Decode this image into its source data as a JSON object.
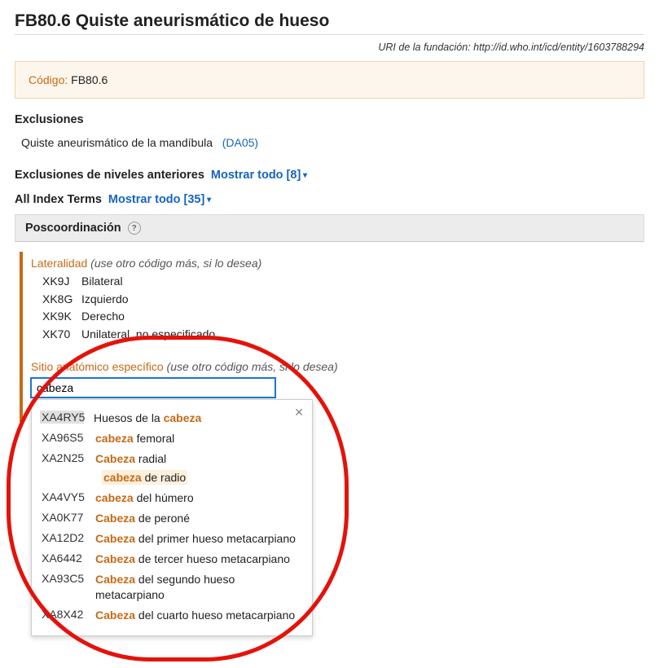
{
  "page_title": "FB80.6 Quiste aneurismático de hueso",
  "uri_label": "URI de la fundación:",
  "uri_value": "http://id.who.int/icd/entity/1603788294",
  "code_label": "Código:",
  "code_value": "FB80.6",
  "exclusions": {
    "heading": "Exclusiones",
    "item_text": "Quiste aneurismático de la mandíbula",
    "item_link": "(DA05)"
  },
  "prior_exclusions": {
    "heading": "Exclusiones de niveles anteriores",
    "show_all": "Mostrar todo [8]"
  },
  "index_terms": {
    "heading": "All Index Terms",
    "show_all": "Mostrar todo [35]"
  },
  "postcoord": {
    "heading": "Poscoordinación",
    "laterality": {
      "title": "Lateralidad",
      "hint": "(use otro código más, si lo desea)",
      "items": [
        {
          "code": "XK9J",
          "label": "Bilateral"
        },
        {
          "code": "XK8G",
          "label": "Izquierdo"
        },
        {
          "code": "XK9K",
          "label": "Derecho"
        },
        {
          "code": "XK70",
          "label": "Unilateral, no especificado"
        }
      ]
    },
    "site": {
      "title": "Sitio anatómico específico",
      "hint": "(use otro código más, si lo desea)",
      "search_value": "cabeza",
      "dropdown": {
        "rows": [
          {
            "code": "XA4RY5",
            "selected": true,
            "pre": "Huesos de la ",
            "hl": "cabeza",
            "post": ""
          },
          {
            "code": "XA96S5",
            "selected": false,
            "pre": "",
            "hl": "cabeza",
            "post": " femoral"
          },
          {
            "code": "XA2N25",
            "selected": false,
            "pre": "",
            "hl": "Cabeza",
            "post": " radial",
            "sub": {
              "pre": "",
              "hl": "cabeza",
              "post": " de radio"
            }
          },
          {
            "code": "XA4VY5",
            "selected": false,
            "pre": "",
            "hl": "cabeza",
            "post": " del húmero"
          },
          {
            "code": "XA0K77",
            "selected": false,
            "pre": "",
            "hl": "Cabeza",
            "post": " de peroné"
          },
          {
            "code": "XA12D2",
            "selected": false,
            "pre": "",
            "hl": "Cabeza",
            "post": " del primer hueso metacarpiano"
          },
          {
            "code": "XA6442",
            "selected": false,
            "pre": "",
            "hl": "Cabeza",
            "post": " de tercer hueso metacarpiano"
          },
          {
            "code": "XA93C5",
            "selected": false,
            "pre": "",
            "hl": "Cabeza",
            "post": " del segundo hueso metacarpiano"
          },
          {
            "code": "XA8X42",
            "selected": false,
            "pre": "",
            "hl": "Cabeza",
            "post": " del cuarto hueso metacarpiano"
          }
        ]
      }
    }
  }
}
